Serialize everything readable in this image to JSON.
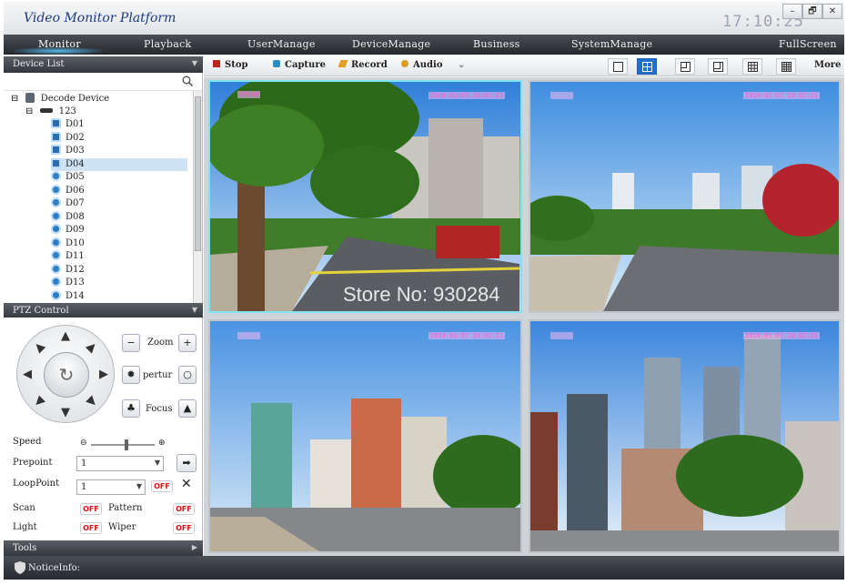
{
  "app": {
    "title": "Video Monitor Platform",
    "clock": "17:10:25"
  },
  "window_buttons": {
    "minimize": "–",
    "restore": "🗗",
    "close": "✕"
  },
  "menu": [
    {
      "label": "Monitor",
      "active": true
    },
    {
      "label": "Playback"
    },
    {
      "label": "UserManage"
    },
    {
      "label": "DeviceManage"
    },
    {
      "label": "Business"
    },
    {
      "label": "SystemManage"
    },
    {
      "label": "FullScreen"
    }
  ],
  "device_list": {
    "header": "Device List",
    "root": "Decode Device",
    "group": "123",
    "items": [
      "D01",
      "D02",
      "D03",
      "D04",
      "D05",
      "D06",
      "D07",
      "D08",
      "D09",
      "D10",
      "D11",
      "D12",
      "D13",
      "D14"
    ],
    "selected": "D04"
  },
  "ptz": {
    "header": "PTZ Control",
    "zoom_label": "Zoom",
    "aperture_label": "pertur",
    "focus_label": "Focus",
    "speed_label": "Speed",
    "speed_level": 0.55,
    "prepoint_label": "Prepoint",
    "prepoint_value": "1",
    "looppoint_label": "LoopPoint",
    "looppoint_value": "1",
    "looppoint_state": "OFF",
    "scan_label": "Scan",
    "scan_state": "OFF",
    "pattern_label": "Pattern",
    "pattern_state": "OFF",
    "light_label": "Light",
    "light_state": "OFF",
    "wiper_label": "Wiper",
    "wiper_state": "OFF"
  },
  "toolbar": {
    "stop": "Stop",
    "capture": "Capture",
    "record": "Record",
    "audio": "Audio",
    "more": "More"
  },
  "video": {
    "timestamp": "2014-03-07 18:02:21",
    "cell1_name": "IPCAM",
    "watermark": "Store No: 930284"
  },
  "tools_header": "Tools",
  "status": {
    "notice": "NoticeInfo:"
  }
}
